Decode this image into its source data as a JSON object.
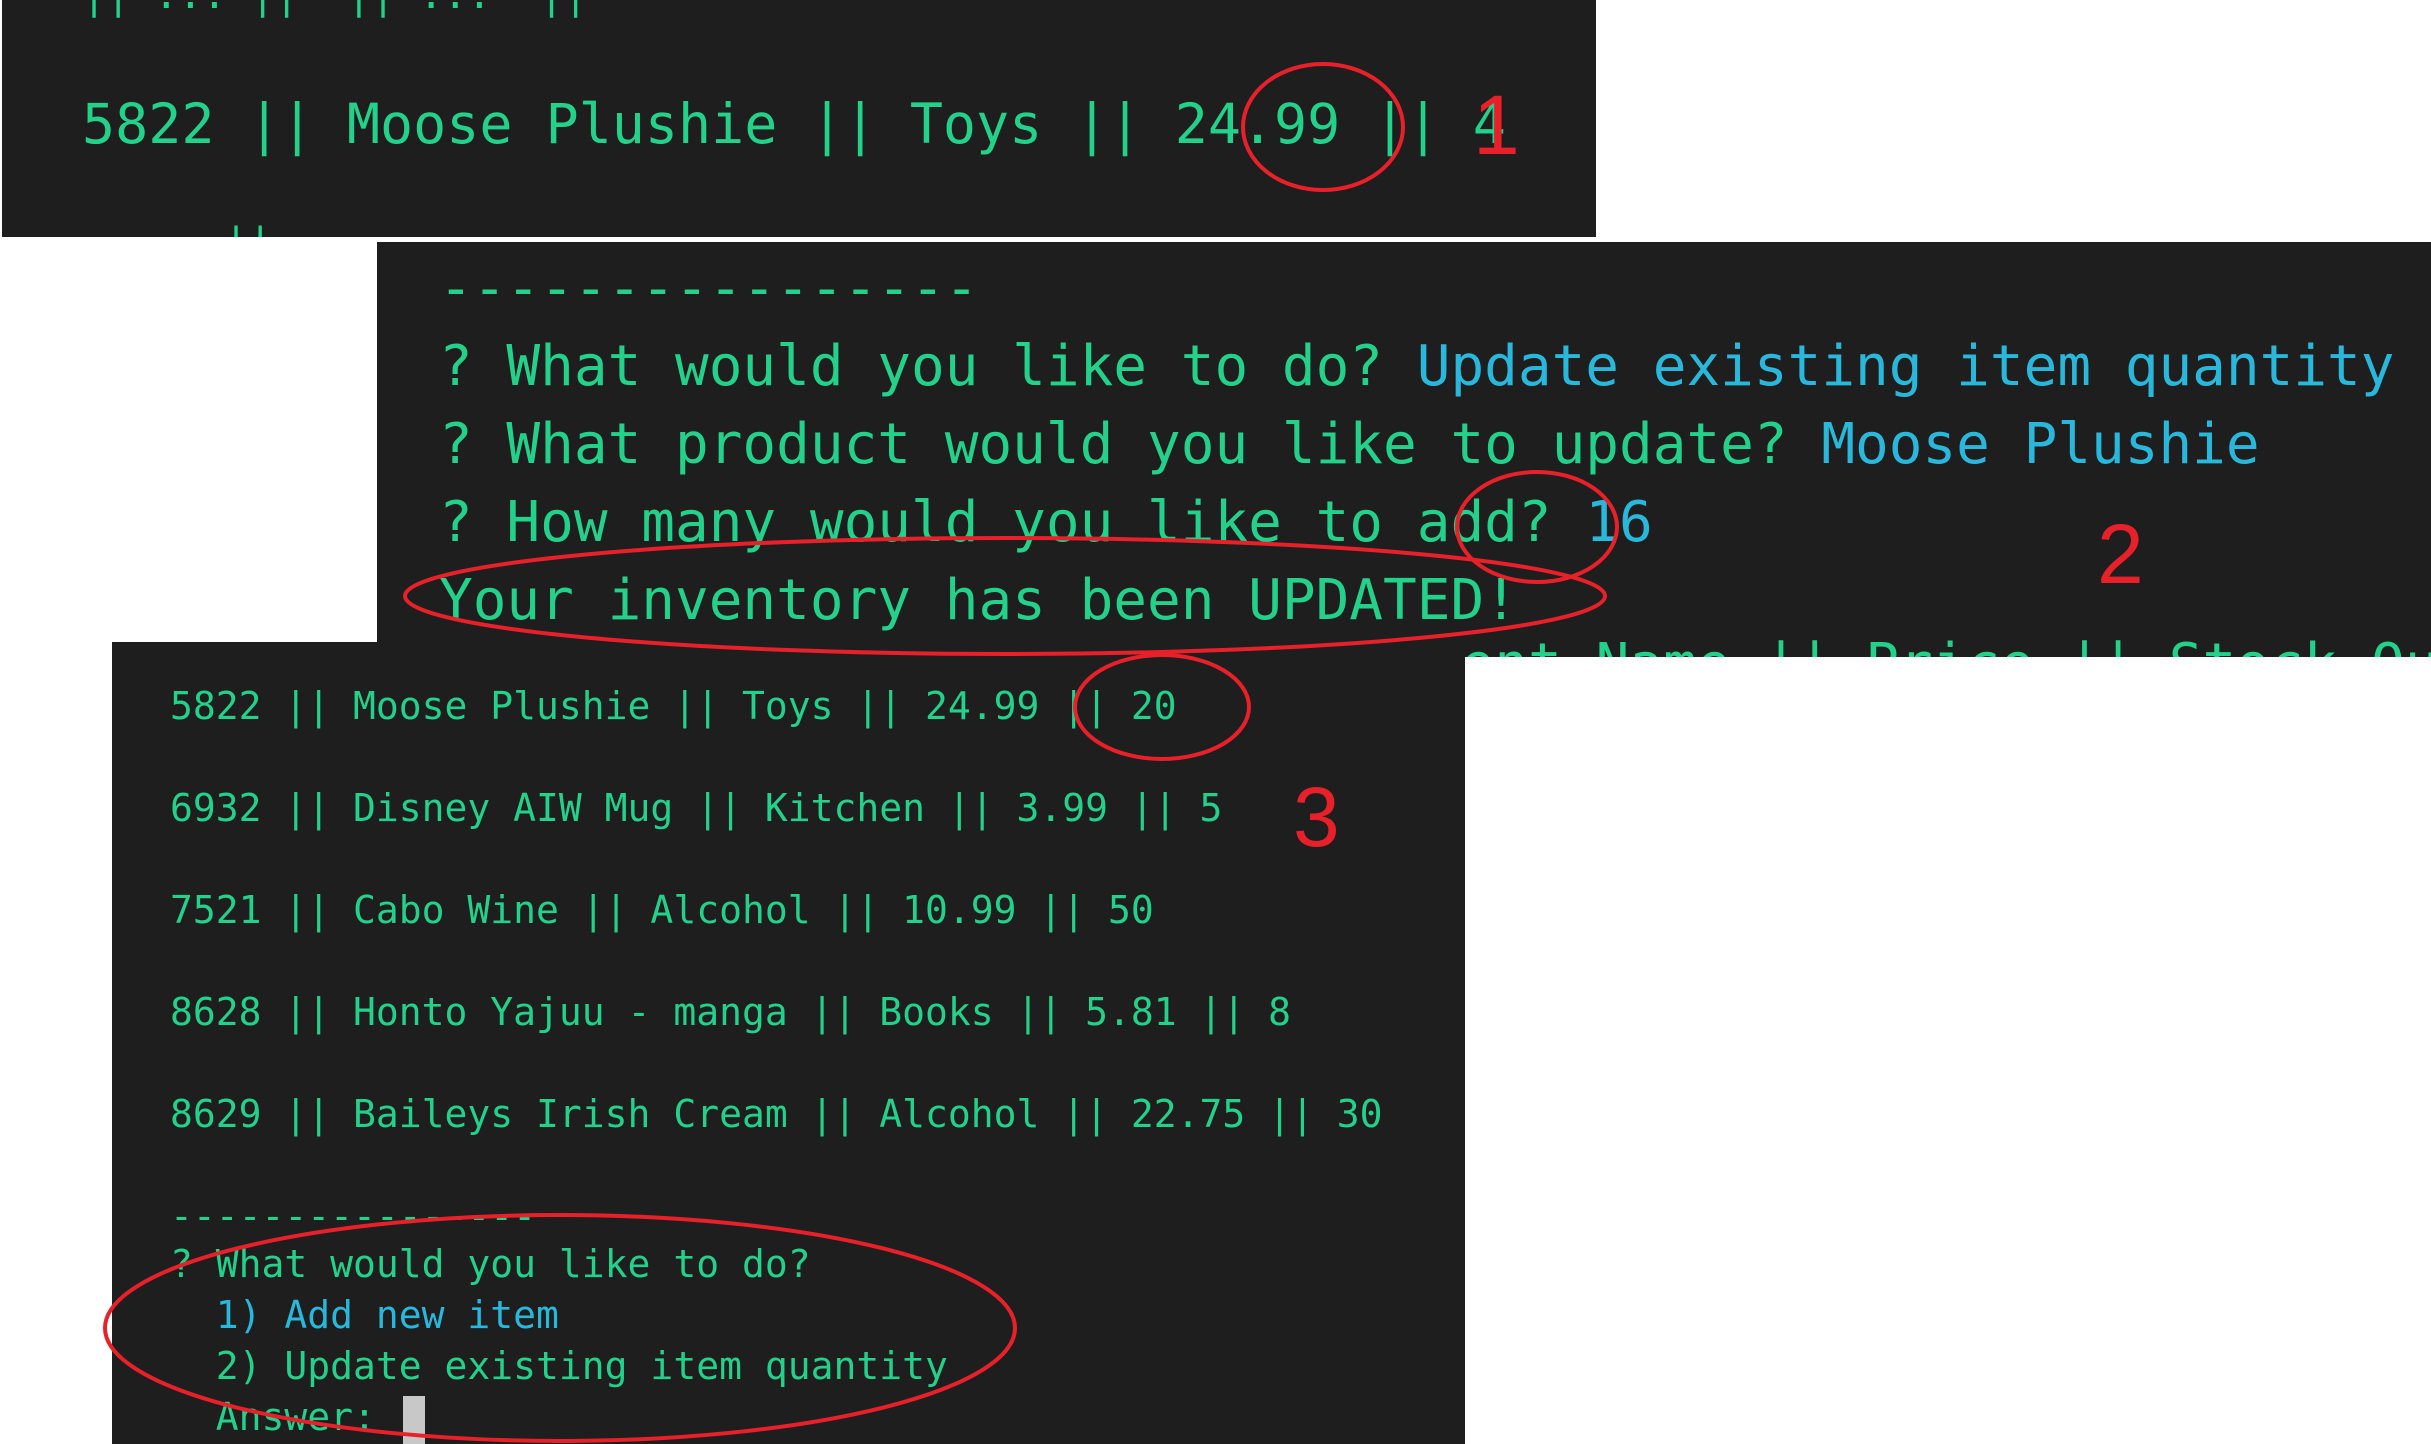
{
  "panel1": {
    "top_line_fragment": "|| ... ||  || ...  ||",
    "row": "5822 || Moose Plushie || Toys || 24.99 || 4",
    "bottom_fragment": "||"
  },
  "panel2": {
    "separator": "----------------",
    "q1_prompt": "? What would you like to do? ",
    "q1_answer": "Update existing item quantity",
    "q2_prompt": "? What product would you like to update? ",
    "q2_answer": "Moose Plushie",
    "q3_prompt": "? How many would you like to add? ",
    "q3_answer": "16",
    "confirmation": "Your inventory has been UPDATED!",
    "header_fragment": "ment Name || Price || Stock Qua"
  },
  "panel3": {
    "rows": [
      "5822 || Moose Plushie || Toys || 24.99 || 20",
      "6932 || Disney AIW Mug || Kitchen || 3.99 || 5",
      "7521 || Cabo Wine || Alcohol || 10.99 || 50",
      "8628 || Honto Yajuu - manga || Books || 5.81 || 8",
      "8629 || Baileys Irish Cream || Alcohol || 22.75 || 30"
    ],
    "separator": "----------------",
    "question": "? What would you like to do?",
    "option1": "  1) Add new item",
    "option2": "  2) Update existing item quantity",
    "answer_label": "  Answer: "
  },
  "annotations": {
    "label1": "1",
    "label2": "2",
    "label3": "3",
    "color": "#e8202a"
  },
  "colors": {
    "terminal_bg": "#1e1e1e",
    "text_green": "#23d18b",
    "text_blue": "#29b8db"
  }
}
